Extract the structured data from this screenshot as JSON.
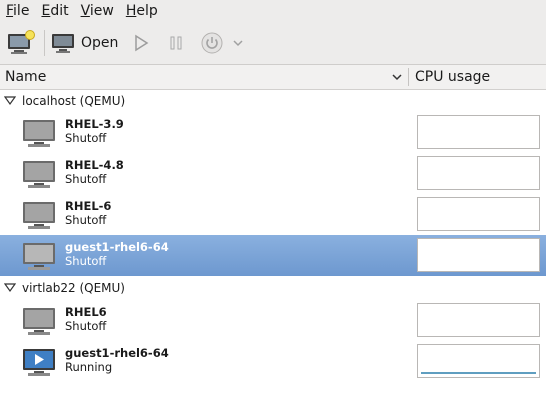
{
  "menubar": {
    "items": [
      {
        "mnemonic": "F",
        "rest": "ile"
      },
      {
        "mnemonic": "E",
        "rest": "dit"
      },
      {
        "mnemonic": "V",
        "rest": "iew"
      },
      {
        "mnemonic": "H",
        "rest": "elp"
      }
    ]
  },
  "toolbar": {
    "new_icon": "new-vm-icon",
    "open_label": "Open",
    "run_icon": "play-icon",
    "pause_icon": "pause-icon",
    "shutdown_icon": "power-icon",
    "shutdown_menu_icon": "chevron-down-icon"
  },
  "header": {
    "name_label": "Name",
    "cpu_label": "CPU usage"
  },
  "connections": [
    {
      "label": "localhost (QEMU)",
      "vms": [
        {
          "name": "RHEL-3.9",
          "state": "Shutoff",
          "selected": false,
          "running": false
        },
        {
          "name": "RHEL-4.8",
          "state": "Shutoff",
          "selected": false,
          "running": false
        },
        {
          "name": "RHEL-6",
          "state": "Shutoff",
          "selected": false,
          "running": false
        },
        {
          "name": "guest1-rhel6-64",
          "state": "Shutoff",
          "selected": true,
          "running": false
        }
      ]
    },
    {
      "label": "virtlab22 (QEMU)",
      "vms": [
        {
          "name": "RHEL6",
          "state": "Shutoff",
          "selected": false,
          "running": false
        },
        {
          "name": "guest1-rhel6-64",
          "state": "Running",
          "selected": false,
          "running": true
        }
      ]
    }
  ],
  "colors": {
    "selection": "#7aa3d8",
    "cpu_graph": "#5f9ec0"
  }
}
